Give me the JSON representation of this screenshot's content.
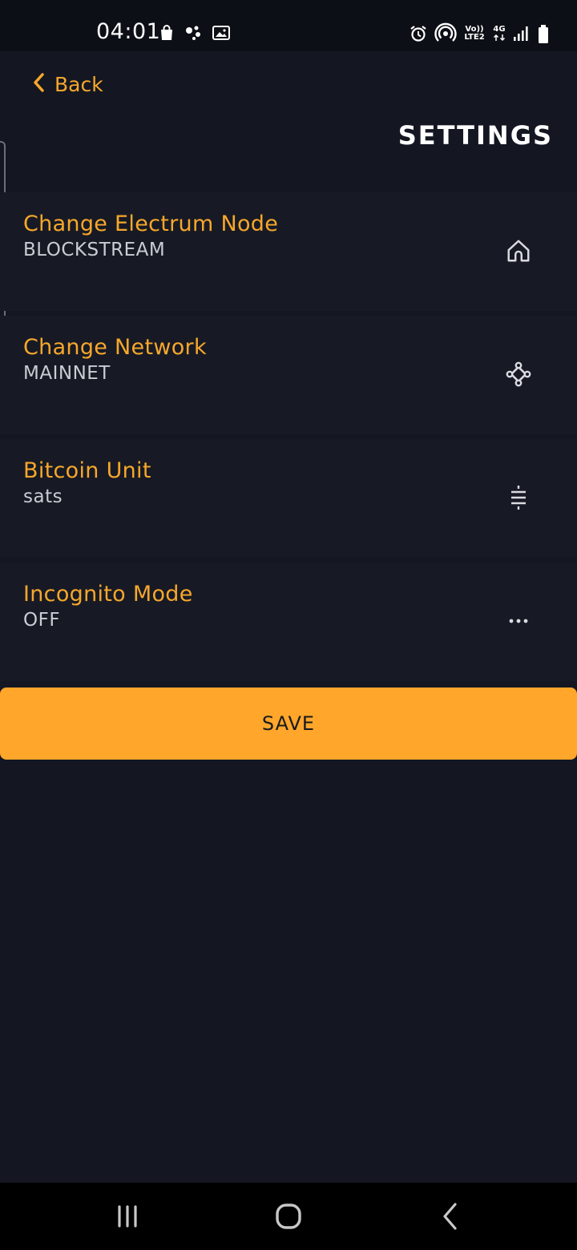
{
  "status_bar": {
    "time": "04:01",
    "left_icons": [
      "shopping-bag-icon",
      "assistant-dots-icon",
      "image-icon"
    ],
    "right_icons": [
      "alarm-icon",
      "hotspot-icon",
      "volte-icon",
      "4g-icon",
      "signal-icon",
      "battery-icon"
    ],
    "volte_label_top": "Vo))",
    "volte_label_bottom": "LTE2",
    "network_label": "4G"
  },
  "header": {
    "back_label": "Back",
    "title": "SETTINGS"
  },
  "settings": [
    {
      "title": "Change Electrum Node",
      "value": "BLOCKSTREAM",
      "icon": "home-icon"
    },
    {
      "title": "Change Network",
      "value": "MAINNET",
      "icon": "network-nodes-icon"
    },
    {
      "title": "Bitcoin Unit",
      "value": "sats",
      "icon": "sats-unit-icon"
    },
    {
      "title": "Incognito Mode",
      "value": "OFF",
      "icon": "more-dots-icon"
    }
  ],
  "save_label": "SAVE",
  "colors": {
    "background": "#141722",
    "accent": "#f7a72b",
    "button": "#ffa62b",
    "value_text": "#c9ccd2"
  },
  "nav_bar": {
    "buttons": [
      "recent-apps-icon",
      "home-circle-icon",
      "back-chevron-icon"
    ]
  }
}
